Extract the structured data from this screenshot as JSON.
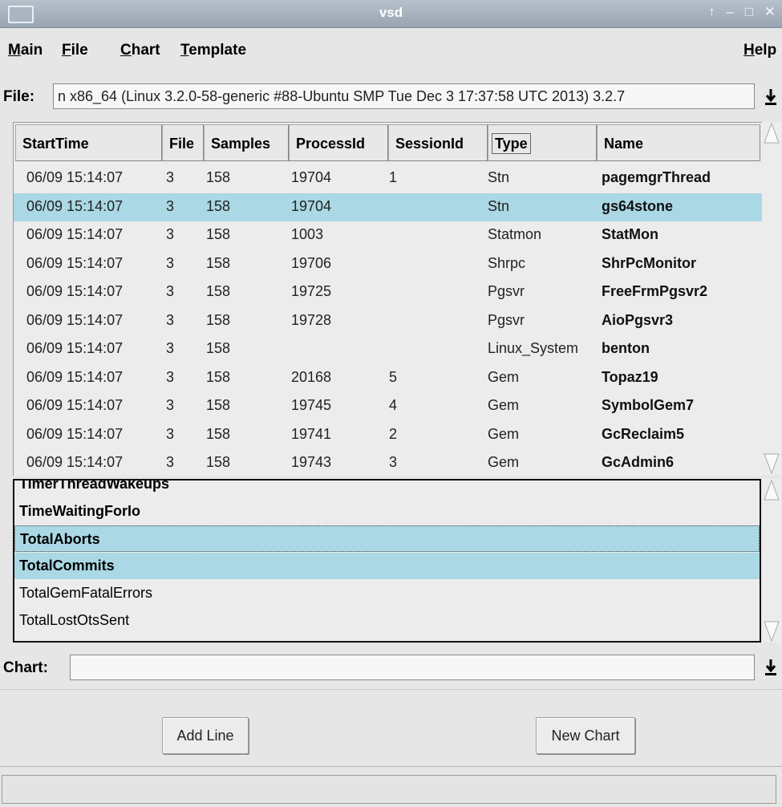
{
  "window": {
    "title": "vsd",
    "controls": [
      "↑",
      "–",
      "□",
      "✕"
    ]
  },
  "menu": {
    "items": [
      {
        "label": "Main",
        "mnemonic": "M",
        "rest": "ain"
      },
      {
        "label": "File",
        "mnemonic": "F",
        "rest": "ile"
      },
      {
        "label": "Chart",
        "mnemonic": "C",
        "rest": "hart"
      },
      {
        "label": "Template",
        "mnemonic": "T",
        "rest": "emplate"
      },
      {
        "label": "Help",
        "mnemonic": "H",
        "rest": "elp"
      }
    ]
  },
  "file_row": {
    "label": "File:",
    "value": "n x86_64 (Linux 3.2.0-58-generic #88-Ubuntu SMP Tue Dec 3 17:37:58 UTC 2013) 3.2.7",
    "dropdown_icon": "down-arrow-to-bar"
  },
  "process_table": {
    "columns": [
      "StartTime",
      "File",
      "Samples",
      "ProcessId",
      "SessionId",
      "Type",
      "Name"
    ],
    "selected_column": "Type",
    "selected_row": 1,
    "rows": [
      [
        "06/09 15:14:07",
        "3",
        "158",
        "19704",
        "1",
        "Stn",
        "pagemgrThread"
      ],
      [
        "06/09 15:14:07",
        "3",
        "158",
        "19704",
        "",
        "Stn",
        "gs64stone"
      ],
      [
        "06/09 15:14:07",
        "3",
        "158",
        "1003",
        "",
        "Statmon",
        "StatMon"
      ],
      [
        "06/09 15:14:07",
        "3",
        "158",
        "19706",
        "",
        "Shrpc",
        "ShrPcMonitor"
      ],
      [
        "06/09 15:14:07",
        "3",
        "158",
        "19725",
        "",
        "Pgsvr",
        "FreeFrmPgsvr2"
      ],
      [
        "06/09 15:14:07",
        "3",
        "158",
        "19728",
        "",
        "Pgsvr",
        "AioPgsvr3"
      ],
      [
        "06/09 15:14:07",
        "3",
        "158",
        "",
        "",
        "Linux_System",
        "benton"
      ],
      [
        "06/09 15:14:07",
        "3",
        "158",
        "20168",
        "5",
        "Gem",
        "Topaz19"
      ],
      [
        "06/09 15:14:07",
        "3",
        "158",
        "19745",
        "4",
        "Gem",
        "SymbolGem7"
      ],
      [
        "06/09 15:14:07",
        "3",
        "158",
        "19741",
        "2",
        "Gem",
        "GcReclaim5"
      ],
      [
        "06/09 15:14:07",
        "3",
        "158",
        "19743",
        "3",
        "Gem",
        "GcAdmin6"
      ]
    ]
  },
  "stat_list": {
    "items": [
      {
        "label": "TimerThreadWakeups",
        "bold": true,
        "selected": false
      },
      {
        "label": "TimeWaitingForIo",
        "bold": true,
        "selected": false
      },
      {
        "label": "TotalAborts",
        "bold": true,
        "selected": true
      },
      {
        "label": "TotalCommits",
        "bold": true,
        "selected": true
      },
      {
        "label": "TotalGemFatalErrors",
        "bold": false,
        "selected": false
      },
      {
        "label": "TotalLostOtsSent",
        "bold": false,
        "selected": false
      }
    ]
  },
  "chart_row": {
    "label": "Chart:",
    "value": "",
    "dropdown_icon": "down-arrow-to-bar"
  },
  "buttons": {
    "add_line": "Add Line",
    "new_chart": "New Chart"
  },
  "status": {
    "text": ""
  },
  "colors": {
    "selection": "#aad8e4",
    "background": "#e6e6e6",
    "titlebar": "#a4afbc"
  }
}
